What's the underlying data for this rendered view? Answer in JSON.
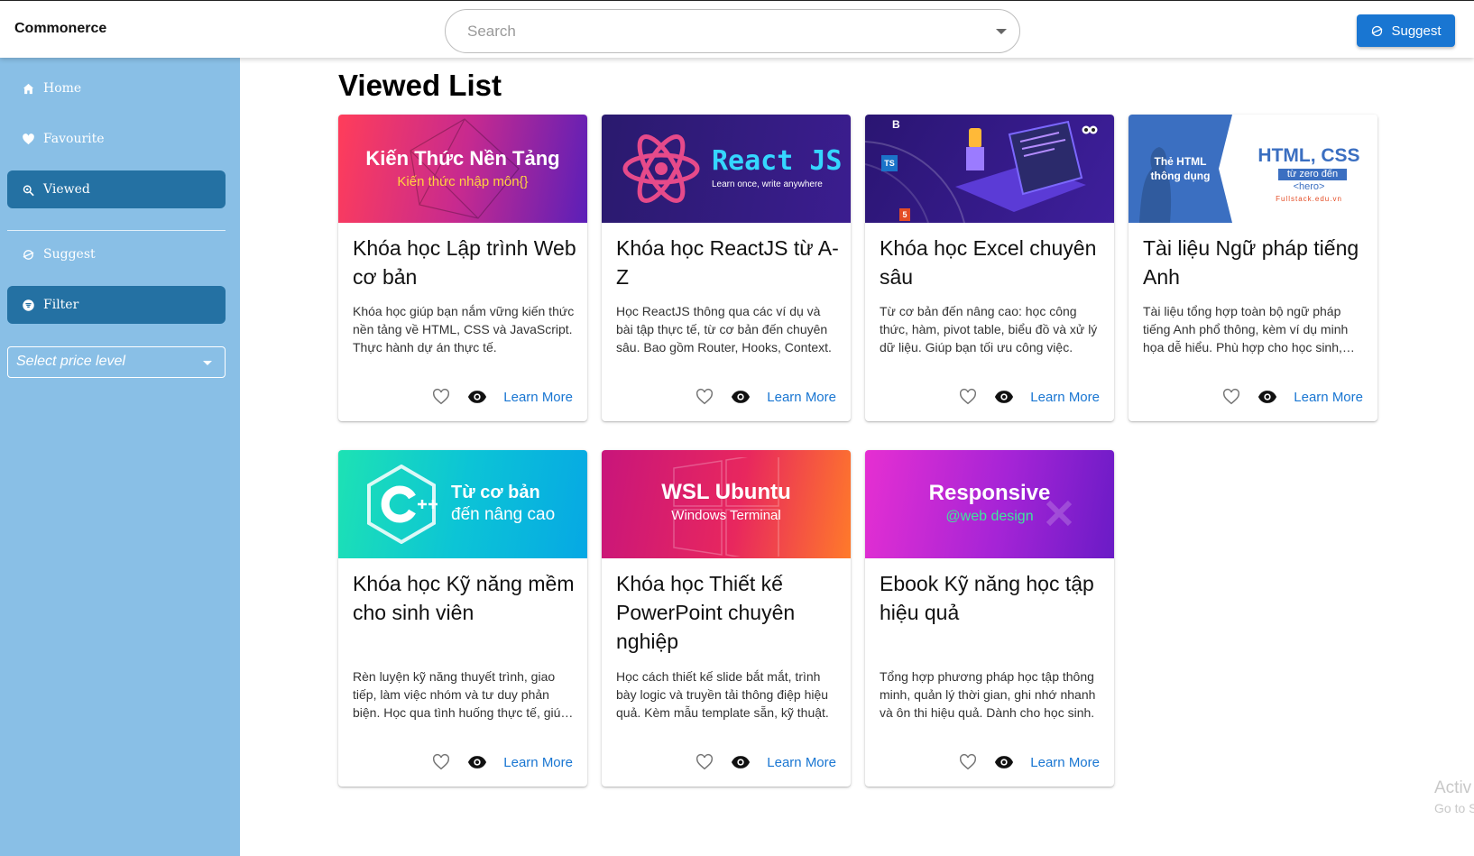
{
  "app": {
    "brand": "Commonerce"
  },
  "search": {
    "placeholder": "Search"
  },
  "header": {
    "suggest_label": "Suggest"
  },
  "sidebar": {
    "items": [
      {
        "label": "Home",
        "icon": "home-icon"
      },
      {
        "label": "Favourite",
        "icon": "heart-icon"
      },
      {
        "label": "Viewed",
        "icon": "viewed-icon",
        "active": true
      },
      {
        "label": "Suggest",
        "icon": "suggest-icon"
      },
      {
        "label": "Filter",
        "icon": "filter-icon",
        "active": true
      }
    ],
    "price_placeholder": "Select price level"
  },
  "page": {
    "title": "Viewed List"
  },
  "learn_more": "Learn More",
  "cards": [
    {
      "title": "Khóa học Lập trình Web cơ bản",
      "desc": "Khóa học giúp bạn nắm vững kiến thức nền tảng về HTML, CSS và JavaScript. Thực hành dự án thực tế.",
      "banner": {
        "line1": "Kiến Thức Nền Tảng",
        "line2": "Kiến thức nhập môn{}"
      }
    },
    {
      "title": "Khóa học ReactJS từ A-Z",
      "desc": "Học ReactJS thông qua các ví dụ và bài tập thực tế, từ cơ bản đến chuyên sâu. Bao gồm Router, Hooks, Context.",
      "banner": {
        "line1": "React JS",
        "line2": "Learn once, write anywhere"
      }
    },
    {
      "title": "Khóa học Excel chuyên sâu",
      "desc": "Từ cơ bản đến nâng cao: học công thức, hàm, pivot table, biểu đồ và xử lý dữ liệu. Giúp bạn tối ưu công việc.",
      "banner": {
        "badge_b": "B",
        "badge_ts": "TS",
        "badge_5": "5"
      }
    },
    {
      "title": "Tài liệu Ngữ pháp tiếng Anh",
      "desc": "Tài liệu tổng hợp toàn bộ ngữ pháp tiếng Anh phổ thông, kèm ví dụ minh họa dễ hiểu. Phù hợp cho học sinh, sinh viên.",
      "banner": {
        "left1": "Thẻ HTML",
        "left2": "thông dụng",
        "right1": "HTML, CSS",
        "right2": "từ zero đến",
        "right3": "<hero>",
        "right4": "Fullstack.edu.vn"
      }
    },
    {
      "title": "Khóa học Kỹ năng mềm cho sinh viên",
      "desc": "Rèn luyện kỹ năng thuyết trình, giao tiếp, làm việc nhóm và tư duy phản biện. Học qua tình huống thực tế, giúp bạn tự tin.",
      "banner": {
        "line1": "Từ cơ bản",
        "line2": "đến nâng cao"
      }
    },
    {
      "title": "Khóa học Thiết kế PowerPoint chuyên nghiệp",
      "desc": "Học cách thiết kế slide bắt mắt, trình bày logic và truyền tải thông điệp hiệu quả. Kèm mẫu template sẵn, kỹ thuật.",
      "banner": {
        "line1": "WSL Ubuntu",
        "line2": "Windows Terminal"
      }
    },
    {
      "title": "Ebook Kỹ năng học tập hiệu quả",
      "desc": "Tổng hợp phương pháp học tập thông minh, quản lý thời gian, ghi nhớ nhanh và ôn thi hiệu quả. Dành cho học sinh.",
      "banner": {
        "line1": "Responsive",
        "line2": "@web design"
      }
    }
  ],
  "watermark": {
    "line1": "Activ",
    "line2": "Go to S"
  },
  "colors": {
    "primary": "#1976d2",
    "sidebar": "#89bfe6",
    "sidebar_active": "#2471a3"
  }
}
